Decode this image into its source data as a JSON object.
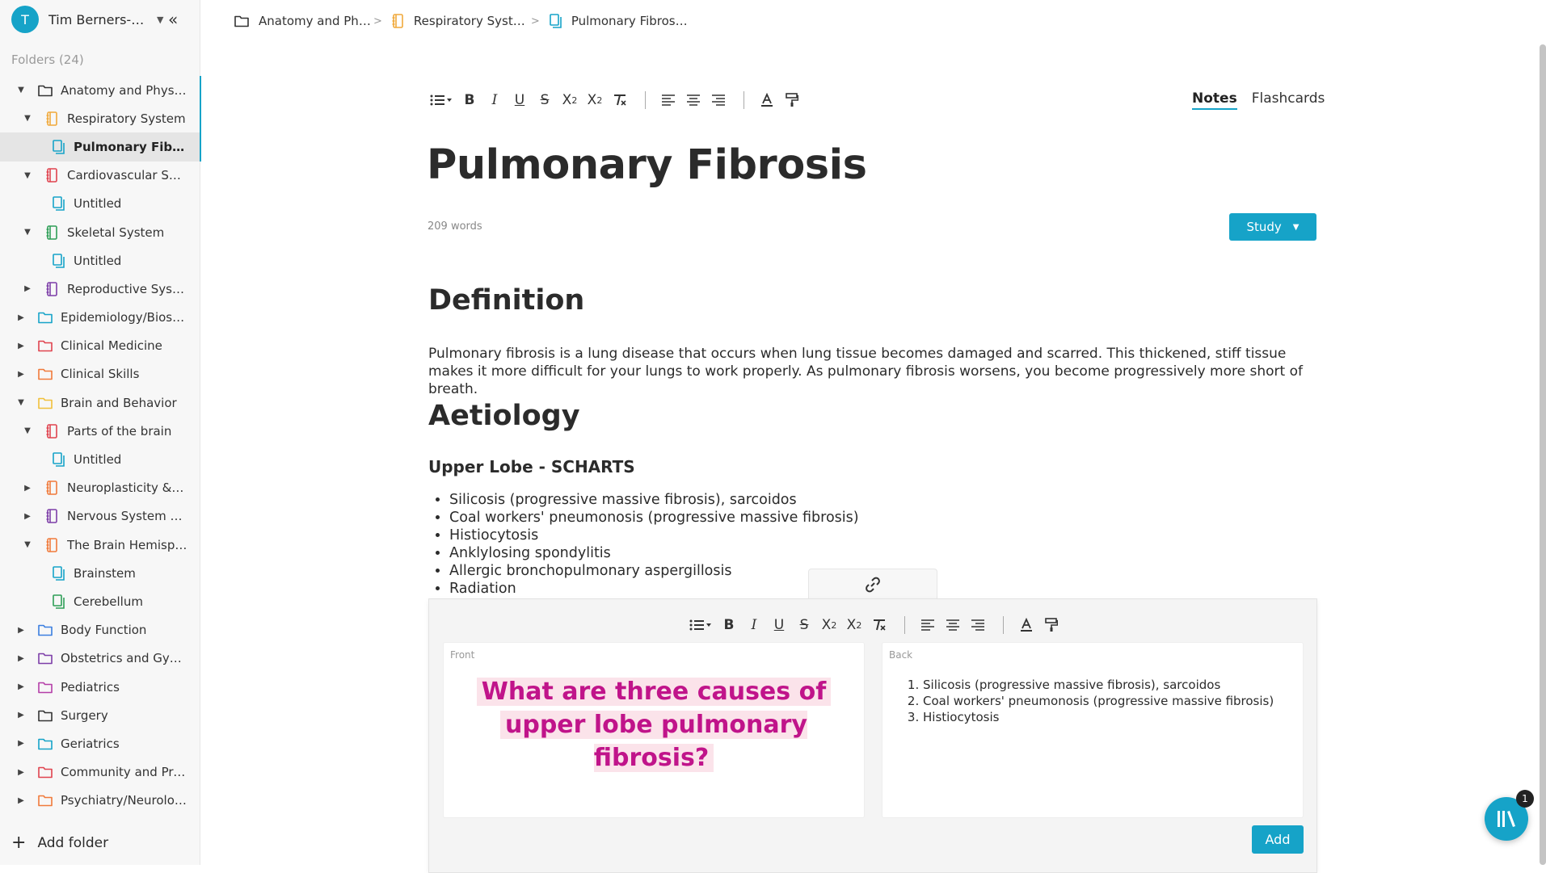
{
  "user": {
    "initial": "T",
    "name": "Tim Berners-Lee"
  },
  "sidebar": {
    "folders_count": "Folders (24)",
    "add_folder": "Add folder",
    "items": [
      {
        "label": "Anatomy and Physiology",
        "level": 0,
        "caret": "down",
        "kind": "folder",
        "color": "#333333"
      },
      {
        "label": "Respiratory System",
        "level": 1,
        "caret": "down",
        "kind": "notebook",
        "color": "#f0a93b"
      },
      {
        "label": "Pulmonary Fibrosis",
        "level": 2,
        "caret": "",
        "kind": "page",
        "color": "#16a3c8",
        "active": true
      },
      {
        "label": "Cardiovascular System",
        "level": 1,
        "caret": "down",
        "kind": "notebook",
        "color": "#e0434f"
      },
      {
        "label": "Untitled",
        "level": 2,
        "caret": "",
        "kind": "page",
        "color": "#16a3c8"
      },
      {
        "label": "Skeletal System",
        "level": 1,
        "caret": "down",
        "kind": "notebook",
        "color": "#2e9e57"
      },
      {
        "label": "Untitled",
        "level": 2,
        "caret": "",
        "kind": "page",
        "color": "#16a3c8"
      },
      {
        "label": "Reproductive System",
        "level": 1,
        "caret": "right",
        "kind": "notebook",
        "color": "#7d3ea8"
      },
      {
        "label": "Epidemiology/Biostatistics",
        "level": 0,
        "caret": "right",
        "kind": "folder",
        "color": "#16a3c8"
      },
      {
        "label": "Clinical Medicine",
        "level": 0,
        "caret": "right",
        "kind": "folder",
        "color": "#e0434f"
      },
      {
        "label": "Clinical Skills",
        "level": 0,
        "caret": "right",
        "kind": "folder",
        "color": "#f07a3b"
      },
      {
        "label": "Brain and Behavior",
        "level": 0,
        "caret": "down",
        "kind": "folder",
        "color": "#f0c03b"
      },
      {
        "label": "Parts of the brain",
        "level": 1,
        "caret": "down",
        "kind": "notebook",
        "color": "#e0434f"
      },
      {
        "label": "Untitled",
        "level": 2,
        "caret": "",
        "kind": "page",
        "color": "#16a3c8"
      },
      {
        "label": "Neuroplasticity & Learning",
        "level": 1,
        "caret": "right",
        "kind": "notebook",
        "color": "#f07a3b"
      },
      {
        "label": "Nervous System Function",
        "level": 1,
        "caret": "right",
        "kind": "notebook",
        "color": "#7d3ea8"
      },
      {
        "label": "The Brain Hemispheres",
        "level": 1,
        "caret": "down",
        "kind": "notebook",
        "color": "#f07a3b"
      },
      {
        "label": "Brainstem",
        "level": 2,
        "caret": "",
        "kind": "page",
        "color": "#16a3c8"
      },
      {
        "label": "Cerebellum",
        "level": 2,
        "caret": "",
        "kind": "page",
        "color": "#2e9e57"
      },
      {
        "label": "Body Function",
        "level": 0,
        "caret": "right",
        "kind": "folder",
        "color": "#3b7fe0"
      },
      {
        "label": "Obstetrics and Gynecology",
        "level": 0,
        "caret": "right",
        "kind": "folder",
        "color": "#7d3ea8"
      },
      {
        "label": "Pediatrics",
        "level": 0,
        "caret": "right",
        "kind": "folder",
        "color": "#b43ea8"
      },
      {
        "label": "Surgery",
        "level": 0,
        "caret": "right",
        "kind": "folder",
        "color": "#333333"
      },
      {
        "label": "Geriatrics",
        "level": 0,
        "caret": "right",
        "kind": "folder",
        "color": "#16a3c8"
      },
      {
        "label": "Community and Preventive",
        "level": 0,
        "caret": "right",
        "kind": "folder",
        "color": "#e0434f"
      },
      {
        "label": "Psychiatry/Neurology",
        "level": 0,
        "caret": "right",
        "kind": "folder",
        "color": "#f07a3b"
      }
    ]
  },
  "breadcrumb": [
    {
      "label": "Anatomy and Ph…",
      "kind": "folder",
      "color": "#333333"
    },
    {
      "label": "Respiratory Syst…",
      "kind": "notebook",
      "color": "#f0a93b"
    },
    {
      "label": "Pulmonary Fibros…",
      "kind": "page",
      "color": "#16a3c8"
    }
  ],
  "tabs": {
    "notes": "Notes",
    "flashcards": "Flashcards"
  },
  "doc": {
    "title": "Pulmonary Fibrosis",
    "word_count": "209 words",
    "study_label": "Study",
    "definition_heading": "Definition",
    "definition_text": "Pulmonary fibrosis is a lung disease that occurs when lung tissue becomes damaged and scarred. This thickened, stiff tissue makes it more difficult for your lungs to work properly. As pulmonary fibrosis worsens, you become progressively more short of breath.",
    "aetiology_heading": "Aetiology",
    "upper_lobe_heading": "Upper Lobe - SCHARTS",
    "upper_lobe_items": [
      "Silicosis (progressive massive fibrosis), sarcoidos",
      "Coal workers' pneumonosis (progressive massive fibrosis)",
      "Histiocytosis",
      "Anklylosing spondylitis",
      "Allergic bronchopulmonary aspergillosis",
      "Radiation"
    ]
  },
  "flashcard": {
    "front_label": "Front",
    "back_label": "Back",
    "front_line1": "What are three causes of",
    "front_line2": "upper lobe pulmonary fibrosis?",
    "back_items": [
      "Silicosis (progressive massive fibrosis), sarcoidos",
      "Coal workers' pneumonosis (progressive massive fibrosis)",
      "Histiocytosis"
    ],
    "add_label": "Add"
  },
  "fab": {
    "badge": "1"
  },
  "colors": {
    "accent": "#16a3c8",
    "highlight_text": "#c0148a",
    "highlight_bg": "#fbe3ea"
  }
}
